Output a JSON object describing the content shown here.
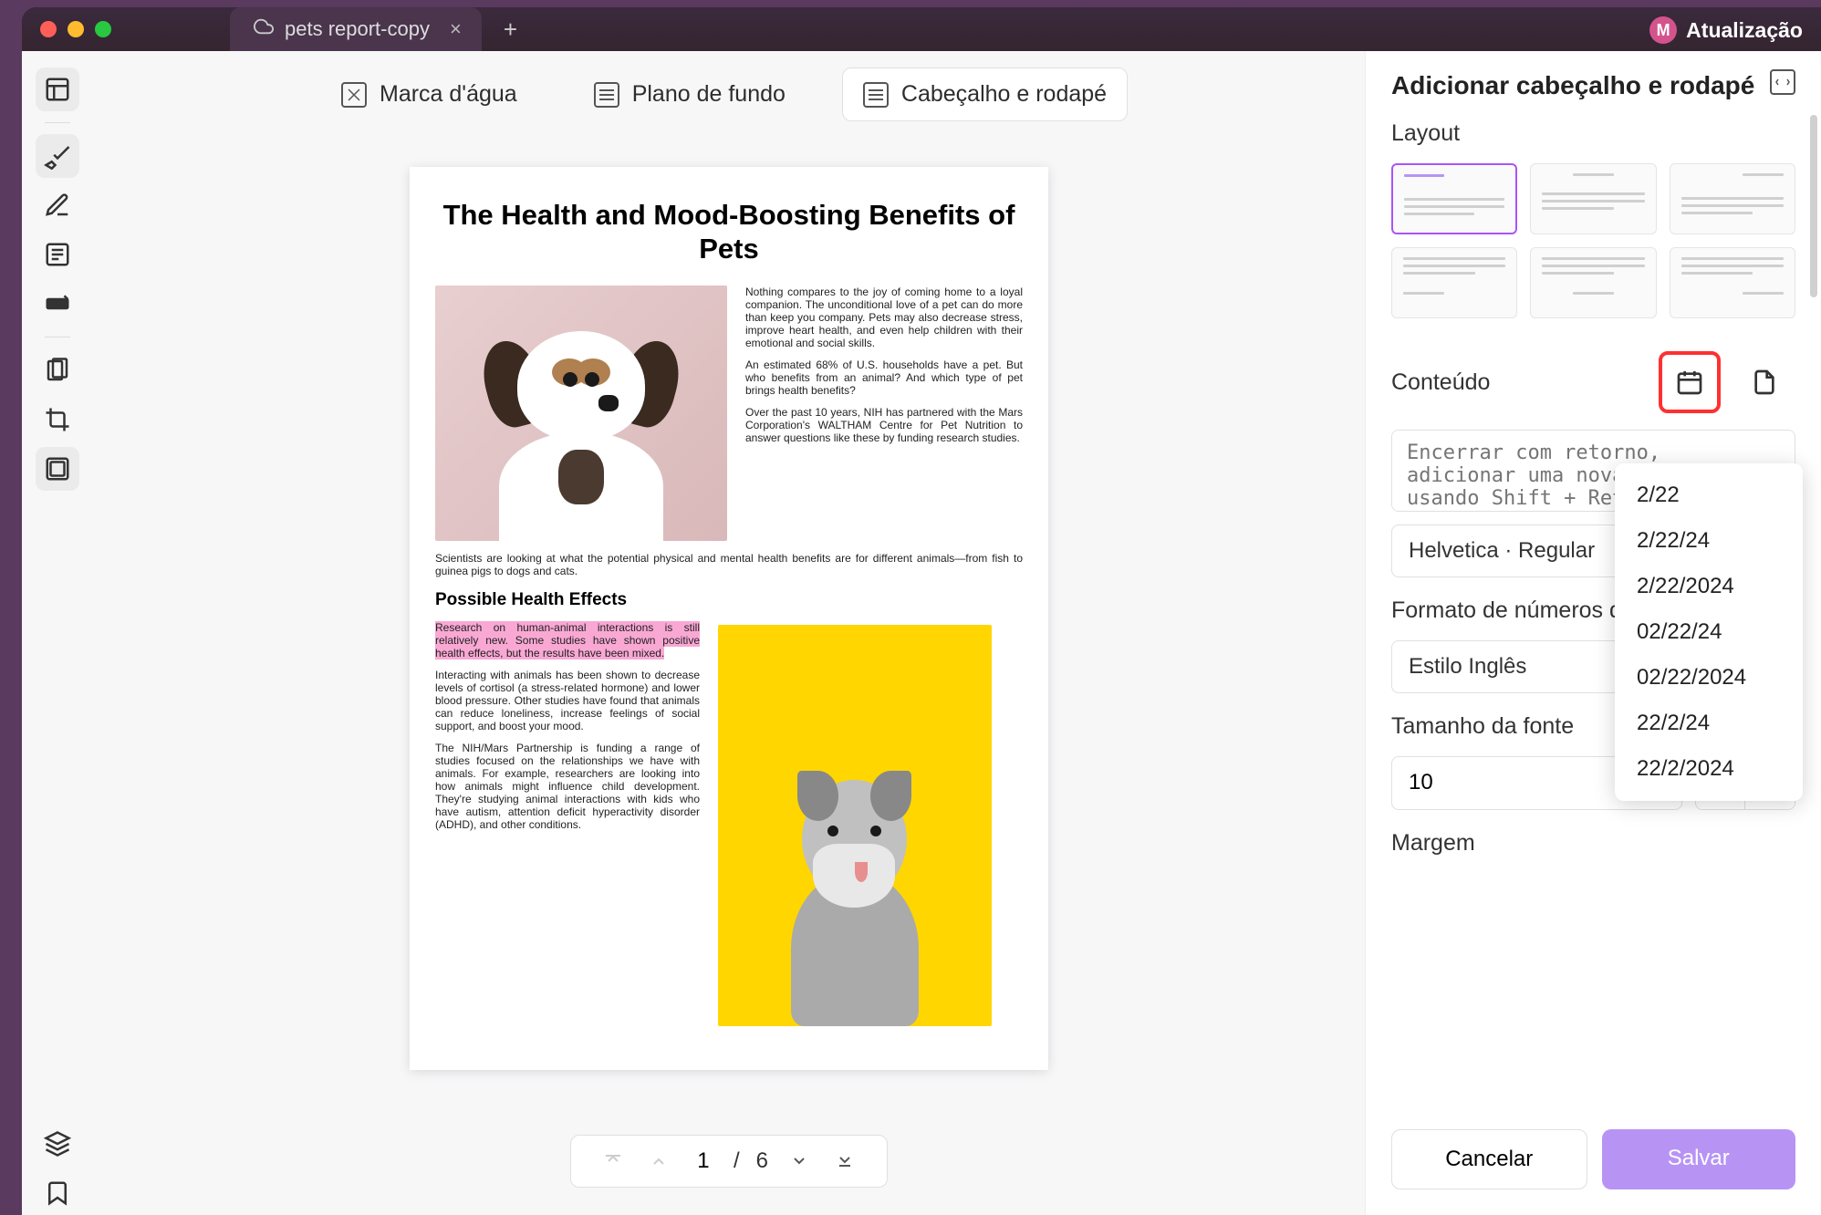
{
  "titlebar": {
    "tab_title": "pets report-copy",
    "update_label": "Atualização"
  },
  "top_tabs": {
    "watermark": "Marca d'água",
    "background": "Plano de fundo",
    "header_footer": "Cabeçalho e rodapé"
  },
  "document": {
    "title": "The Health and Mood-Boosting Benefits of Pets",
    "p1": "Nothing compares to the joy of coming home to a loyal companion. The unconditional love of a pet can do more than keep you company. Pets may also decrease stress, improve heart health, and even help children with their emotional and social skills.",
    "p2": "An estimated 68% of U.S. households have a pet. But who benefits from an animal? And which type of pet brings health benefits?",
    "p3": "Over the past 10 years, NIH has partnered with the Mars Corporation's WALTHAM Centre for Pet Nutrition to answer questions like these by funding research studies.",
    "p4": "Scientists are looking at what the potential physical and mental health benefits are for different animals—from fish to guinea pigs to dogs and cats.",
    "h2": "Possible Health Effects",
    "p5": "Research on human-animal interactions is still relatively new. Some studies have shown positive health effects, but the results have been mixed.",
    "p6": "Interacting with animals has been shown to decrease levels of cortisol (a stress-related hormone) and lower blood pressure. Other studies have found that animals can reduce loneliness, increase feelings of social support, and boost your mood.",
    "p7": "The NIH/Mars Partnership is funding a range of studies focused on the relationships we have with animals. For example, researchers are looking into how animals might influence child development. They're studying animal interactions with kids who have autism, attention deficit hyperactivity disorder (ADHD), and other conditions."
  },
  "pager": {
    "current": "1",
    "total": "6"
  },
  "panel": {
    "title": "Adicionar cabeçalho e rodapé",
    "layout_label": "Layout",
    "content_label": "Conteúdo",
    "content_placeholder": "Encerrar com retorno, adicionar uma nova linha usando Shift + Retorno",
    "font_field": "Helvetica · Regular",
    "number_format_label": "Formato de números de páginas",
    "number_style": "Estilo Inglês",
    "fontsize_label": "Tamanho da fonte",
    "fontsize_value": "10",
    "margin_label": "Margem",
    "cancel": "Cancelar",
    "save": "Salvar"
  },
  "date_options": [
    "2/22",
    "2/22/24",
    "2/22/2024",
    "02/22/24",
    "02/22/2024",
    "22/2/24",
    "22/2/2024"
  ]
}
